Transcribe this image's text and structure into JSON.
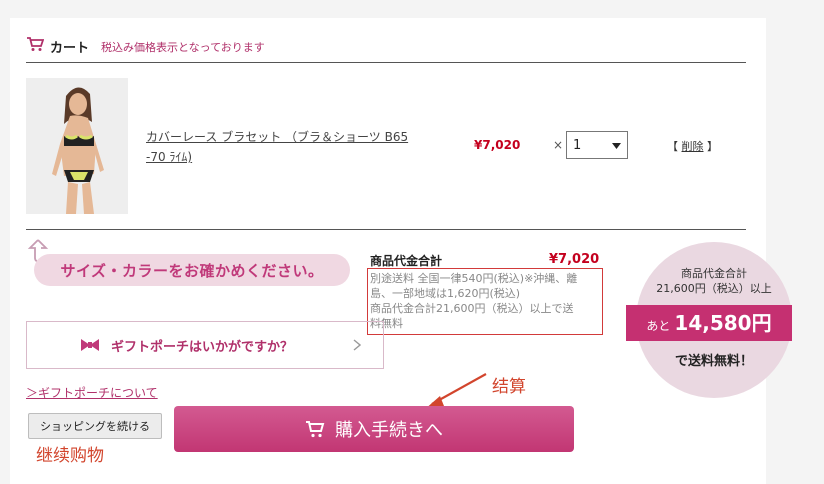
{
  "cart": {
    "title": "カート",
    "tax_note": "税込み価格表示となっております"
  },
  "item": {
    "name": "カバーレース ブラセット （ブラ＆ショーツ B65 -70 ﾗｲﾑ)",
    "price": "¥7,020",
    "times": "×",
    "quantity": "1",
    "delete_open": "【",
    "delete_label": "削除",
    "delete_close": "】"
  },
  "size_notice": "サイズ・カラーをお確かめください。",
  "summary": {
    "label": "商品代金合計",
    "value": "¥7,020",
    "shipping_lines": [
      "別途送料 全国一律540円(税込)※沖縄、離",
      "島、一部地域は1,620円(税込)",
      "商品代金合計21,600円（税込）以上で送",
      "料無料"
    ]
  },
  "free_shipping": {
    "line1": "商品代金合計",
    "line2": "21,600円（税込）以上",
    "prefix": "あと",
    "amount": "14,580円",
    "suffix": "で送料無料！"
  },
  "gift": {
    "label": "ギフトポーチはいかがですか？",
    "link": "＞ギフトポーチについて"
  },
  "buttons": {
    "continue": "ショッピングを続ける",
    "checkout": "購入手続きへ"
  },
  "annotations": {
    "checkout": "结算",
    "continue": "继续购物"
  },
  "colors": {
    "accent": "#c23673",
    "price": "#c4001e",
    "annotation": "#d2452d"
  }
}
